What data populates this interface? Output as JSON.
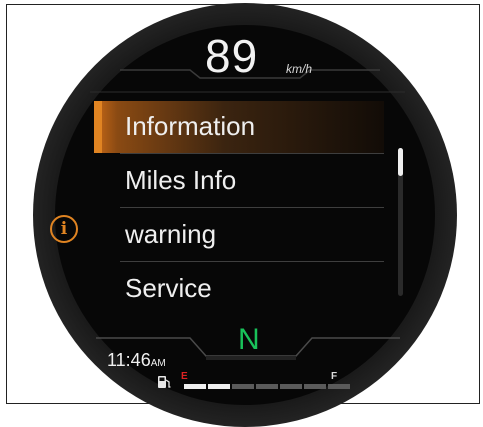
{
  "cluster": {
    "speed_value": "89",
    "speed_unit": "km/h",
    "menu_items": [
      {
        "label": "Information",
        "selected": true
      },
      {
        "label": "Miles Info",
        "selected": false
      },
      {
        "label": "warning",
        "selected": false
      },
      {
        "label": "Service",
        "selected": false
      }
    ],
    "scroll_position": 0,
    "info_icon": "info-icon",
    "info_icon_glyph": "i",
    "gear": "N",
    "time": "11:46",
    "time_suffix": "AM",
    "fuel": {
      "icon": "fuel-pump-icon",
      "empty_label": "E",
      "full_label": "F",
      "segments_total": 7,
      "segments_filled": 2
    },
    "colors": {
      "accent": "#e08422",
      "gear": "#19c25a",
      "empty_mark": "#dd2222"
    }
  }
}
